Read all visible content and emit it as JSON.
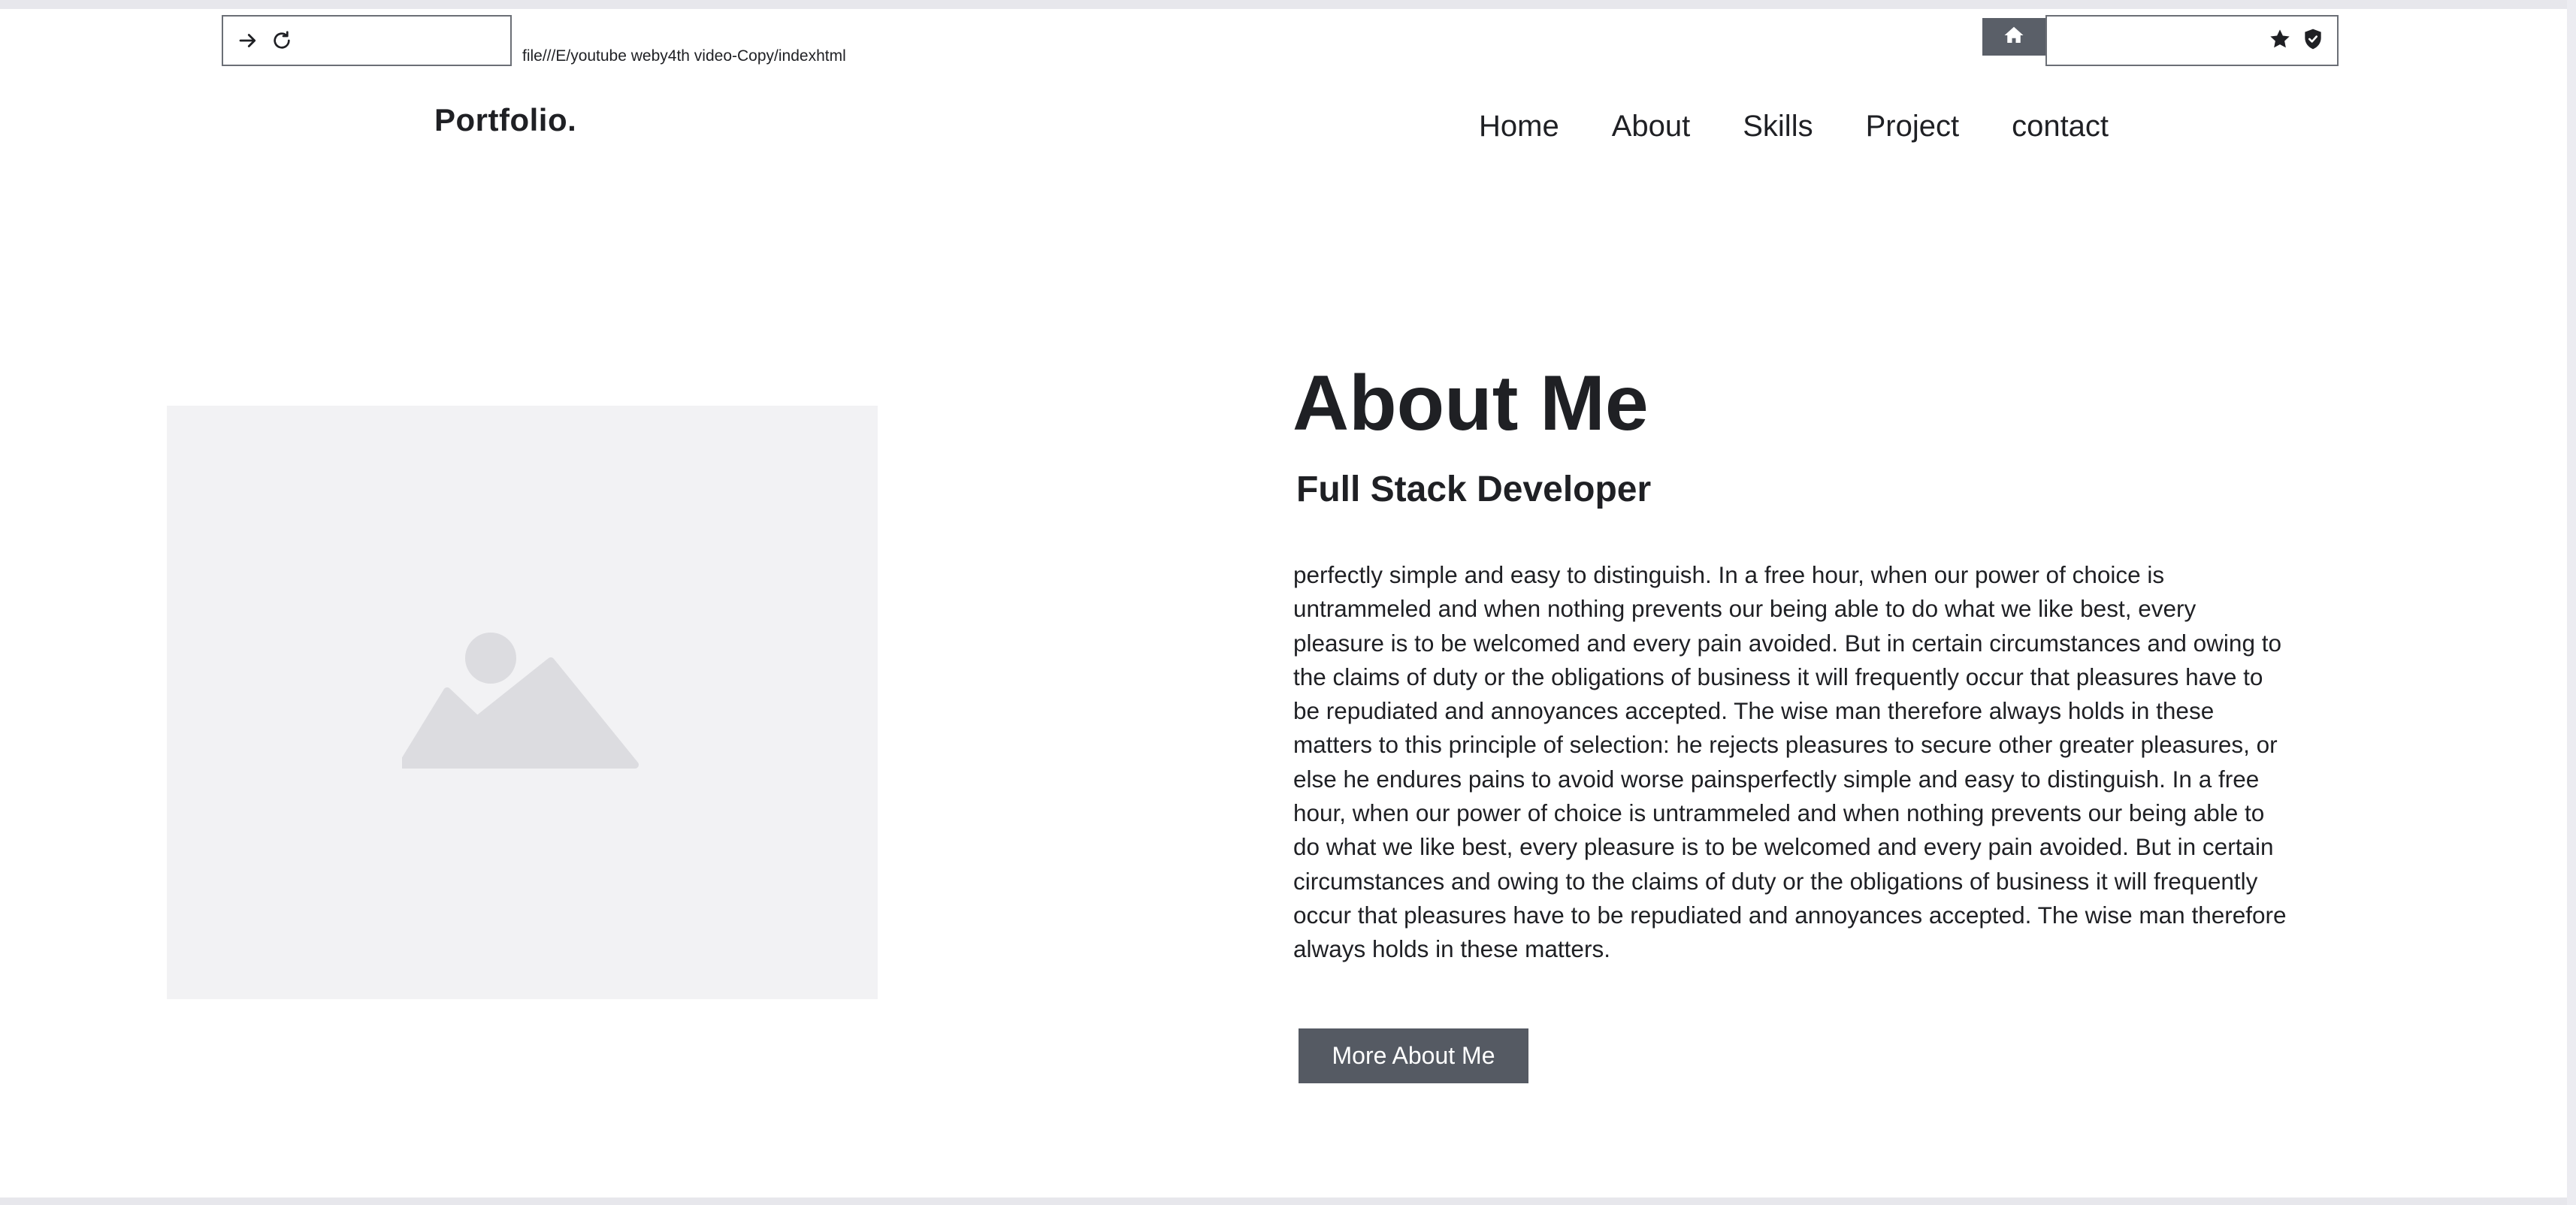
{
  "browser": {
    "url": "file///E/youtube weby4th video-Copy/indexhtml",
    "icons": [
      "arrow-right-icon",
      "reload-icon",
      "home-icon",
      "star-icon",
      "shield-icon"
    ]
  },
  "site": {
    "logo": "Portfolio.",
    "nav": [
      "Home",
      "About",
      "Skills",
      "Project",
      "contact"
    ]
  },
  "about": {
    "title": "About Me",
    "subtitle": "Full Stack Developer",
    "text": "perfectly simple and easy to distinguish. In a free hour, when our power of choice is untrammeled and when nothing prevents our being able to do what we like best, every pleasure is to be welcomed and every pain avoided. But in certain circumstances and owing to the claims of duty or the obligations of business it will frequently occur that pleasures have to be repudiated and annoyances accepted. The wise man therefore always holds in these matters to this principle of selection: he rejects pleasures to secure other greater pleasures, or else he endures pains to avoid worse painsperfectly simple and easy to distinguish. In a free hour, when our power of choice is untrammeled and when nothing prevents our being able to do what we like best, every pleasure is to be welcomed and every pain avoided. But in certain circumstances and owing to the claims of duty or the obligations of business it will frequently occur that pleasures have to be repudiated and annoyances accepted. The wise man therefore always holds in these matters.",
    "button_label": "More About Me"
  },
  "colors": {
    "button_bg": "#555a63",
    "home_button_bg": "#5a5f68",
    "placeholder_bg": "#f2f2f4",
    "placeholder_icon": "#dcdce0",
    "text": "#1f2024"
  }
}
